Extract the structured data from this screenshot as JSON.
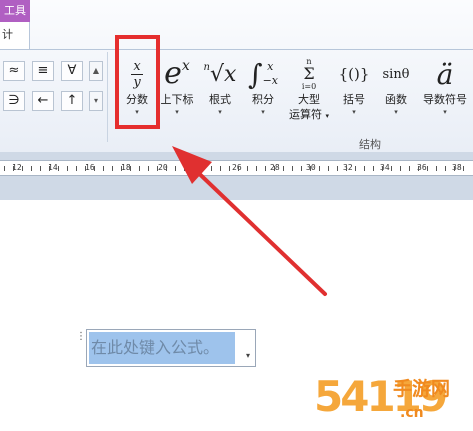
{
  "ribbon": {
    "contextual_tab": "工具",
    "design_tab": "计",
    "symbol_gallery": [
      [
        "≈",
        "≡",
        "∀"
      ],
      [
        "∋",
        "←",
        "↑"
      ]
    ],
    "gallery_scroll": [
      "▲",
      "▾"
    ],
    "tools": [
      {
        "icon_top": "x",
        "icon_bottom": "y",
        "label": "分数",
        "dropdown": "▾"
      },
      {
        "icon": "e",
        "sup": "x",
        "label": "上下标",
        "dropdown": "▾"
      },
      {
        "icon_idx": "n",
        "icon": "√x",
        "label": "根式",
        "dropdown": "▾"
      },
      {
        "icon": "∫",
        "sup": "x",
        "sub": "−x",
        "label": "积分",
        "dropdown": "▾"
      },
      {
        "icon_top": "n",
        "icon": "Σ",
        "icon_bottom": "i=0",
        "label": "大型",
        "label2": "运算符",
        "dropdown": "▾"
      },
      {
        "icon": "{()}",
        "label": "括号",
        "dropdown": "▾"
      },
      {
        "icon": "sinθ",
        "label": "函数",
        "dropdown": "▾"
      },
      {
        "icon": "ä",
        "label": "导数符号",
        "dropdown": "▾"
      }
    ],
    "group_label": "结构"
  },
  "ruler": {
    "marks": [
      "12",
      "14",
      "16",
      "18",
      "20",
      "24",
      "26",
      "28",
      "30",
      "32",
      "34",
      "36",
      "38",
      "40"
    ]
  },
  "equation": {
    "handle": "⋮",
    "placeholder": "在此处键入公式。",
    "dropdown": "▾"
  },
  "watermark": {
    "digits": "54119",
    "cn": "手游网",
    "url": ".cn"
  },
  "colors": {
    "highlight": "#e52e2e",
    "arrow": "#e03030",
    "contextual_tab": "#b05fc2",
    "equation_selection": "#9ec3ec"
  }
}
